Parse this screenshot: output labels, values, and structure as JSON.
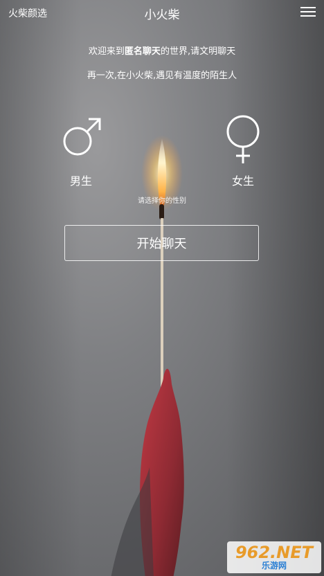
{
  "header": {
    "left_label": "火柴颜选",
    "title": "小火柴"
  },
  "welcome": {
    "prefix": "欢迎来到",
    "highlight": "匿名聊天",
    "suffix": "的世界,请文明聊天"
  },
  "tagline": "再一次,在小火柴,遇见有温度的陌生人",
  "gender": {
    "male_label": "男生",
    "female_label": "女生",
    "hint": "请选择你的性别"
  },
  "start_button": "开始聊天",
  "watermark": {
    "big": "962.NET",
    "small": "乐游网"
  },
  "colors": {
    "text": "#ffffff",
    "background": "#7f8083",
    "flame": "#ffcf6e",
    "hand": "#a8323a"
  }
}
